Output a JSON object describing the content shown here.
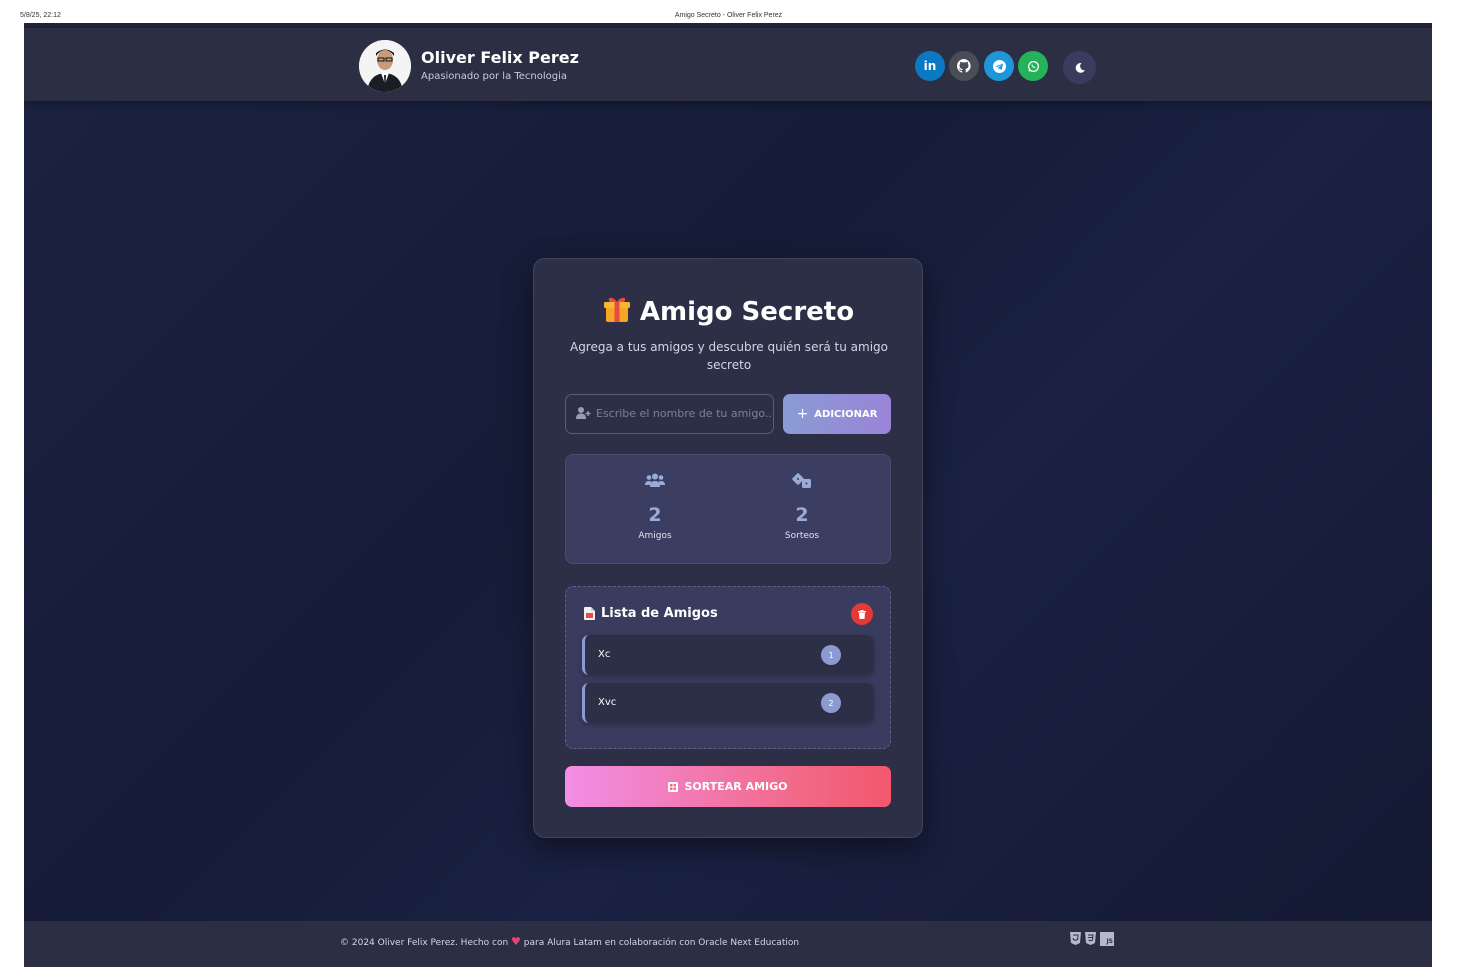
{
  "print": {
    "date": "5/8/25, 22:12",
    "title": "Amigo Secreto - Oliver Felix Perez"
  },
  "header": {
    "name": "Oliver Felix Perez",
    "tagline": "Apasionado por la Tecnologia",
    "social": [
      {
        "icon": "linkedin-icon",
        "label": "in",
        "color": "#0a78c2"
      },
      {
        "icon": "github-icon",
        "color": "#4a4d55"
      },
      {
        "icon": "telegram-icon",
        "color": "#1e96d8"
      },
      {
        "icon": "whatsapp-icon",
        "color": "#25b35a"
      }
    ],
    "theme_toggle_icon": "moon-icon"
  },
  "card": {
    "title": "Amigo Secreto",
    "title_icon": "gift-icon",
    "subtitle": "Agrega a tus amigos y descubre quién será tu amigo secreto",
    "input_placeholder": "Escribe el nombre de tu amigo...",
    "input_value": "",
    "add_label": "ADICIONAR",
    "stats": {
      "friends_count": "2",
      "friends_label": "Amigos",
      "draws_count": "2",
      "draws_label": "Sorteos"
    },
    "list": {
      "title": "Lista de Amigos",
      "items": [
        {
          "name": "Xc",
          "number": "1"
        },
        {
          "name": "Xvc",
          "number": "2"
        }
      ]
    },
    "draw_label": "SORTEAR AMIGO"
  },
  "footer": {
    "text_before": "© 2024 Oliver Felix Perez. Hecho con",
    "text_after": "para Alura Latam en colaboración con Oracle Next Education",
    "tech": [
      "html5-icon",
      "css3-icon",
      "js-icon"
    ],
    "js_label": "JS"
  },
  "colors": {
    "accent": "#8a9bd4",
    "danger": "#e53935",
    "draw_gradient_start": "#f28ee6",
    "draw_gradient_end": "#f2576d"
  }
}
